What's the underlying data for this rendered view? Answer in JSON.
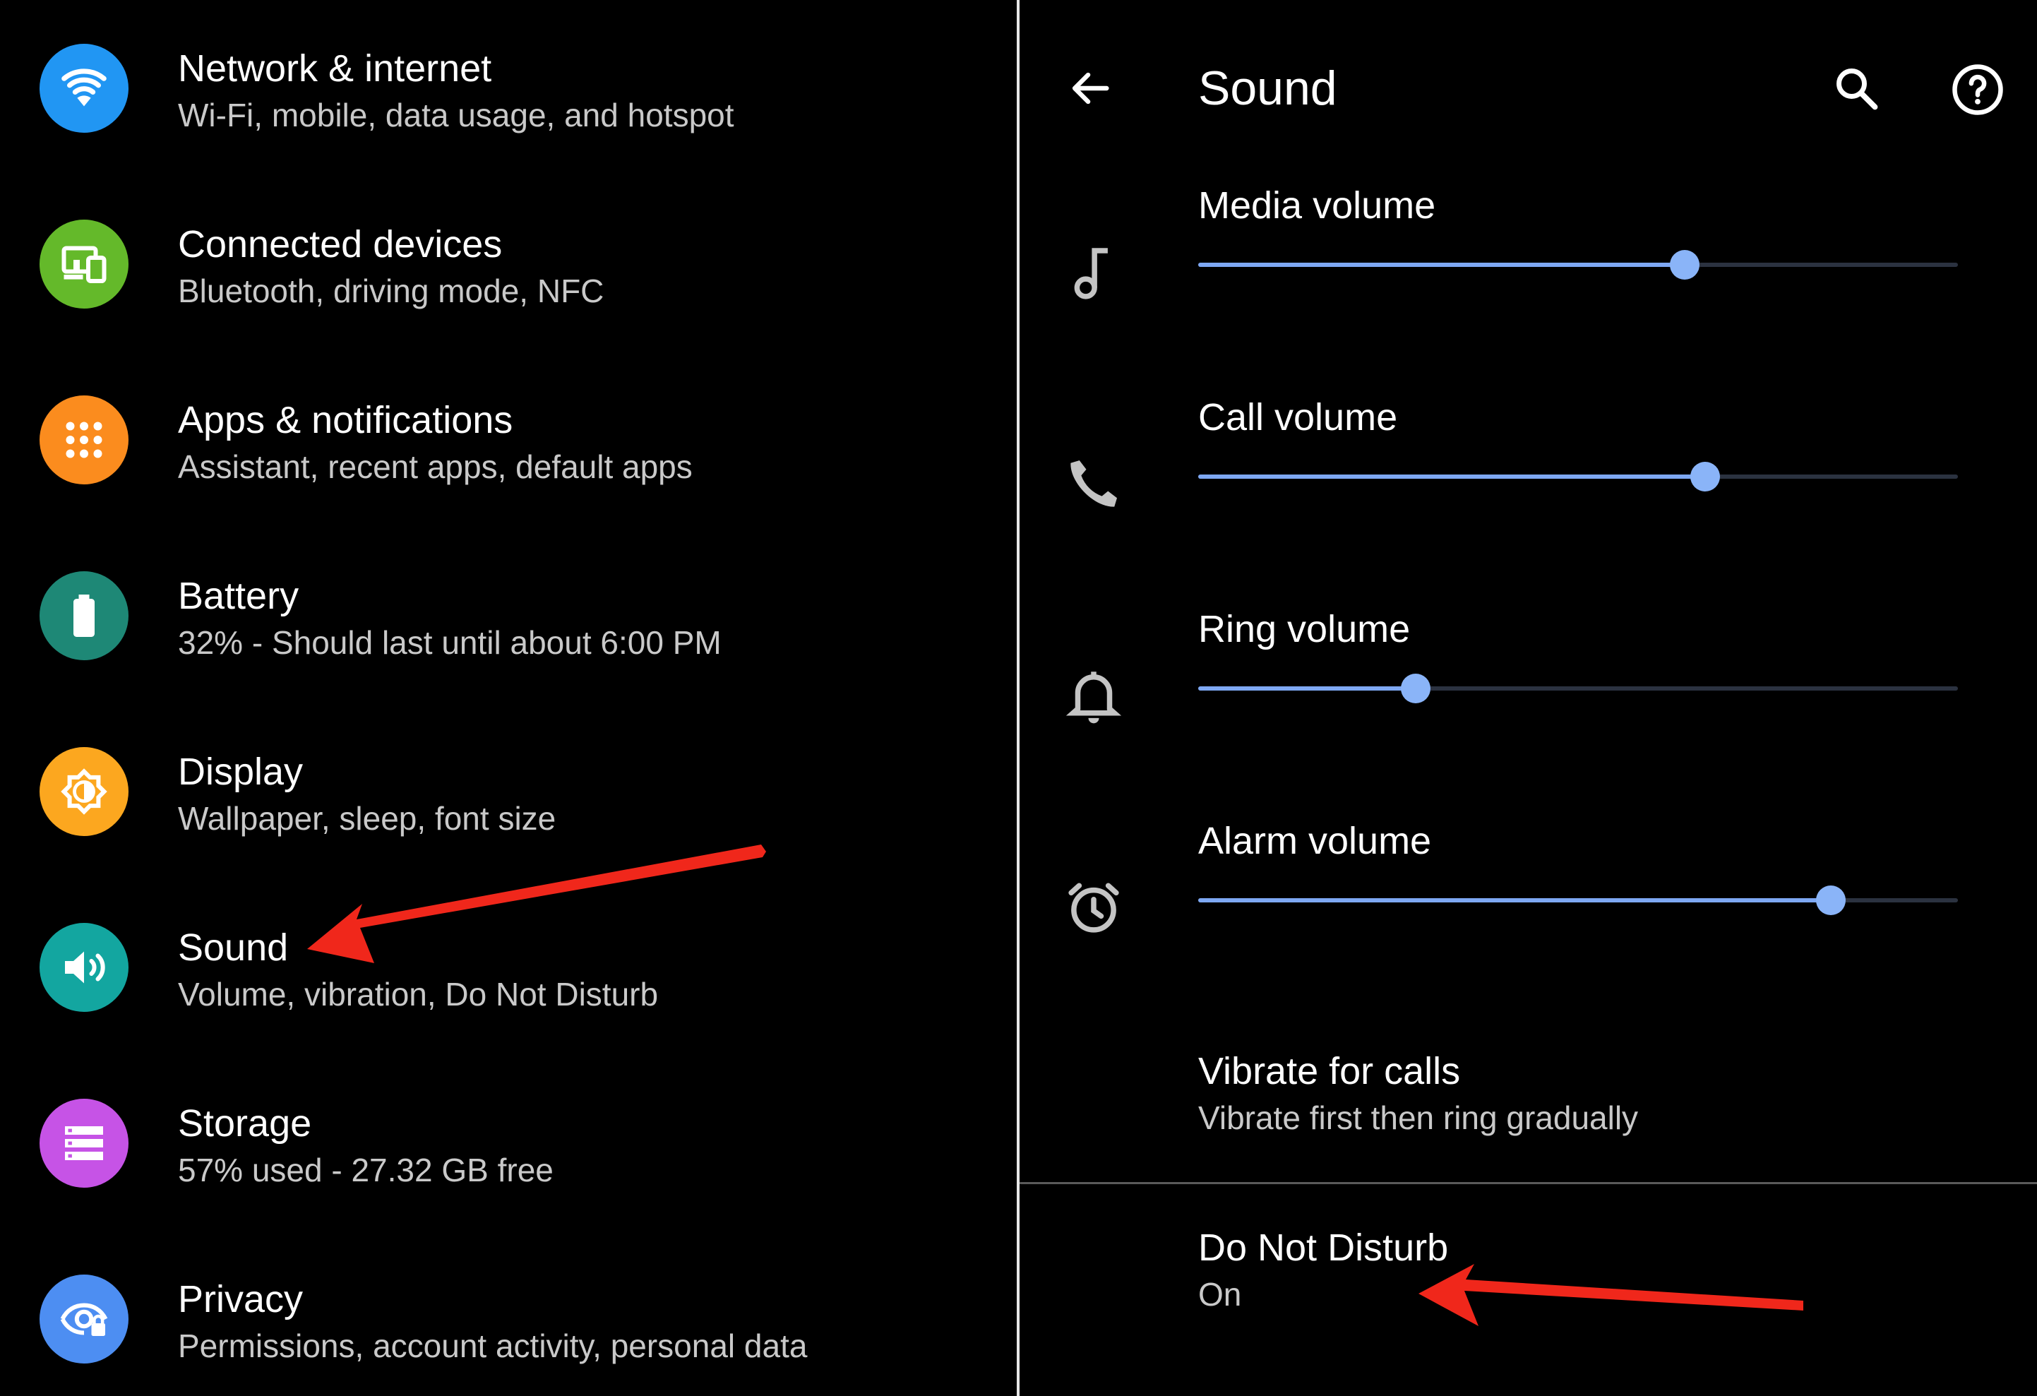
{
  "left_panel": {
    "items": [
      {
        "title": "Network & internet",
        "subtitle": "Wi-Fi, mobile, data usage, and hotspot",
        "icon": "wifi-icon",
        "color": "#2196f3"
      },
      {
        "title": "Connected devices",
        "subtitle": "Bluetooth, driving mode, NFC",
        "icon": "devices-icon",
        "color": "#64b92a"
      },
      {
        "title": "Apps & notifications",
        "subtitle": "Assistant, recent apps, default apps",
        "icon": "apps-grid-icon",
        "color": "#fb8c1e"
      },
      {
        "title": "Battery",
        "subtitle": "32% - Should last until about 6:00 PM",
        "icon": "battery-icon",
        "color": "#1e8876"
      },
      {
        "title": "Display",
        "subtitle": "Wallpaper, sleep, font size",
        "icon": "brightness-icon",
        "color": "#fca71f"
      },
      {
        "title": "Sound",
        "subtitle": "Volume, vibration, Do Not Disturb",
        "icon": "volume-icon",
        "color": "#13a6a0"
      },
      {
        "title": "Storage",
        "subtitle": "57% used - 27.32 GB free",
        "icon": "storage-icon",
        "color": "#c653e6"
      },
      {
        "title": "Privacy",
        "subtitle": "Permissions, account activity, personal data",
        "icon": "privacy-eye-icon",
        "color": "#4d8ef2"
      }
    ]
  },
  "sound_panel": {
    "title": "Sound",
    "icons": {
      "back": "back-arrow-icon",
      "search": "search-icon",
      "help": "help-icon"
    },
    "volumes": [
      {
        "label": "Media volume",
        "icon": "music-note-icon",
        "level": 0.64
      },
      {
        "label": "Call volume",
        "icon": "phone-icon",
        "level": 0.667
      },
      {
        "label": "Ring volume",
        "icon": "bell-icon",
        "level": 0.286
      },
      {
        "label": "Alarm volume",
        "icon": "alarm-clock-icon",
        "level": 0.833
      }
    ],
    "vibrate": {
      "title": "Vibrate for calls",
      "subtitle": "Vibrate first then ring gradually"
    },
    "dnd": {
      "title": "Do Not Disturb",
      "status": "On"
    }
  },
  "colors": {
    "background": "#000000",
    "slider_active": "#8ab4f8",
    "slider_inactive": "#2b3240",
    "annotation_arrow": "#f0271b"
  }
}
